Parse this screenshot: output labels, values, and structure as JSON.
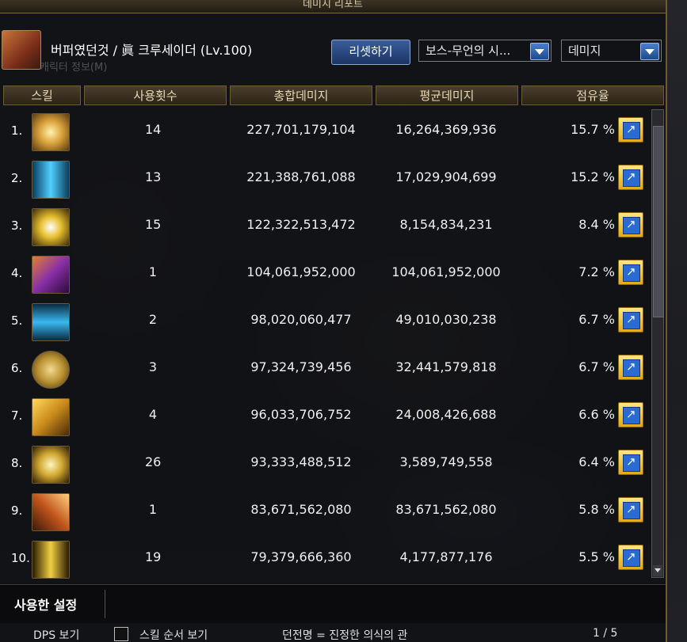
{
  "window": {
    "title": "데미지 리포트"
  },
  "character": {
    "name": "버퍼였던것 / 眞 크루세이더 (Lv.100)",
    "info_label": "캐릭터 정보(M)"
  },
  "toolbar": {
    "reset_label": "리셋하기",
    "target_select": "보스-무언의 시...",
    "metric_select": "데미지"
  },
  "table": {
    "headers": [
      "스킬",
      "사용횟수",
      "총합데미지",
      "평균데미지",
      "점유율"
    ],
    "rows": [
      {
        "rank": "1.",
        "uses": "14",
        "total": "227,701,179,104",
        "avg": "16,264,369,936",
        "share": "15.7 %",
        "icon_color": "#d9a13a"
      },
      {
        "rank": "2.",
        "uses": "13",
        "total": "221,388,761,088",
        "avg": "17,029,904,699",
        "share": "15.2 %",
        "icon_color": "#2a8fc0"
      },
      {
        "rank": "3.",
        "uses": "15",
        "total": "122,322,513,472",
        "avg": "8,154,834,231",
        "share": "8.4 %",
        "icon_color": "#c8a020"
      },
      {
        "rank": "4.",
        "uses": "1",
        "total": "104,061,952,000",
        "avg": "104,061,952,000",
        "share": "7.2 %",
        "icon_color": "#8a2fa8"
      },
      {
        "rank": "5.",
        "uses": "2",
        "total": "98,020,060,477",
        "avg": "49,010,030,238",
        "share": "6.7 %",
        "icon_color": "#1f7db8"
      },
      {
        "rank": "6.",
        "uses": "3",
        "total": "97,324,739,456",
        "avg": "32,441,579,818",
        "share": "6.7 %",
        "icon_color": "#b89030"
      },
      {
        "rank": "7.",
        "uses": "4",
        "total": "96,033,706,752",
        "avg": "24,008,426,688",
        "share": "6.6 %",
        "icon_color": "#c98a1a"
      },
      {
        "rank": "8.",
        "uses": "26",
        "total": "93,333,488,512",
        "avg": "3,589,749,558",
        "share": "6.4 %",
        "icon_color": "#d0a630"
      },
      {
        "rank": "9.",
        "uses": "1",
        "total": "83,671,562,080",
        "avg": "83,671,562,080",
        "share": "5.8 %",
        "icon_color": "#c0551c"
      },
      {
        "rank": "10.",
        "uses": "19",
        "total": "79,379,666,360",
        "avg": "4,177,877,176",
        "share": "5.5 %",
        "icon_color": "#c4a21e"
      }
    ]
  },
  "bottom": {
    "settings_tab": "사용한 설정"
  },
  "footer": {
    "dps_label": "DPS 보기",
    "skill_order_label": "스킬 순서 보기",
    "title_text": "던전명 = 진정한 의식의 관",
    "page": "1 / 5"
  }
}
